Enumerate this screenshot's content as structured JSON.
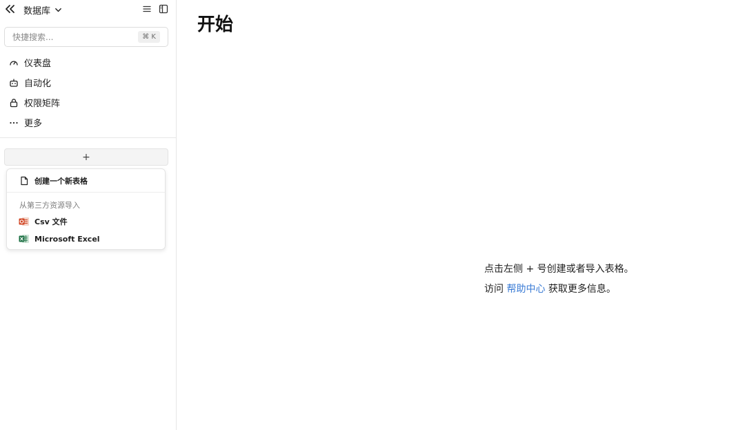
{
  "sidebar": {
    "database_label": "数据库",
    "search": {
      "placeholder": "快捷搜索...",
      "shortcut": "⌘ K"
    },
    "nav_items": [
      {
        "label": "仪表盘",
        "icon": "gauge-icon"
      },
      {
        "label": "自动化",
        "icon": "robot-icon"
      },
      {
        "label": "权限矩阵",
        "icon": "lock-icon"
      },
      {
        "label": "更多",
        "icon": "more-icon"
      }
    ],
    "add_button_label": "+",
    "dropdown": {
      "create_label": "创建一个新表格",
      "import_section_label": "从第三方资源导入",
      "import_items": [
        {
          "label": "Csv 文件",
          "icon": "csv-file-icon",
          "color": "#d24726"
        },
        {
          "label": "Microsoft Excel",
          "icon": "excel-icon",
          "color": "#1e7145"
        }
      ]
    }
  },
  "main": {
    "title": "开始",
    "hint_line1": "点击左侧 + 号创建或者导入表格。",
    "hint_line2_prefix": "访问",
    "help_link": "帮助中心",
    "hint_line2_suffix": "获取更多信息。"
  },
  "colors": {
    "link": "#3a7bd5",
    "border": "#e6e6e6"
  }
}
